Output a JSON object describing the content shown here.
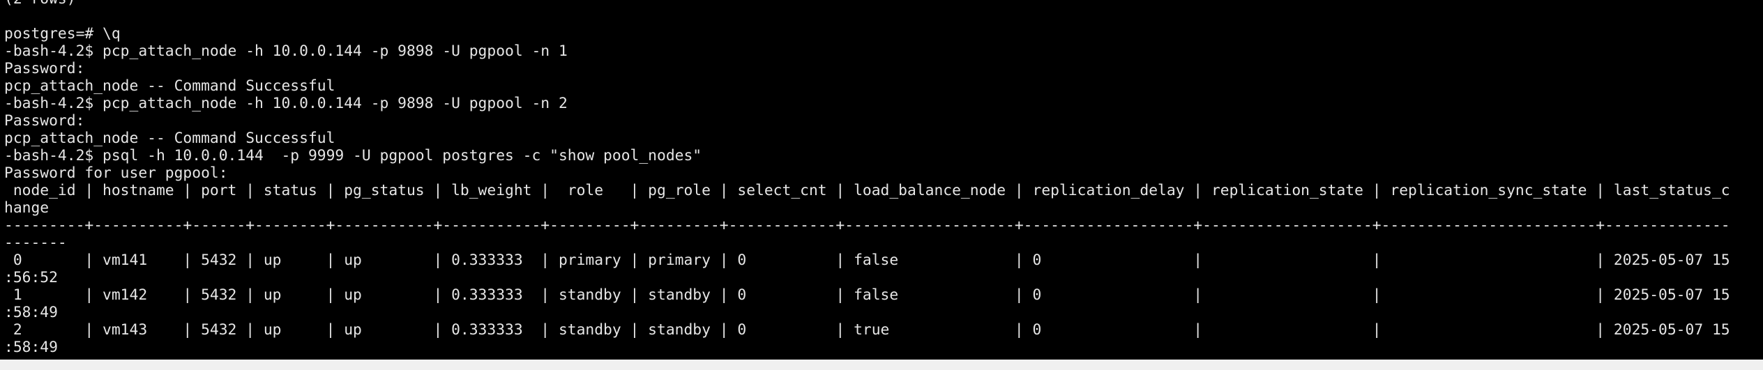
{
  "terminal": {
    "lines": [
      "(2 rows)",
      "",
      "postgres=# \\q",
      "-bash-4.2$ pcp_attach_node -h 10.0.0.144 -p 9898 -U pgpool -n 1",
      "Password:",
      "pcp_attach_node -- Command Successful",
      "-bash-4.2$ pcp_attach_node -h 10.0.0.144 -p 9898 -U pgpool -n 2",
      "Password:",
      "pcp_attach_node -- Command Successful",
      "-bash-4.2$ psql -h 10.0.0.144  -p 9999 -U pgpool postgres -c \"show pool_nodes\"",
      "Password for user pgpool:",
      " node_id | hostname | port | status | pg_status | lb_weight |  role   | pg_role | select_cnt | load_balance_node | replication_delay | replication_state | replication_sync_state | last_status_c",
      "hange",
      "---------+----------+------+--------+-----------+-----------+---------+---------+------------+-------------------+-------------------+-------------------+------------------------+--------------",
      "-------",
      " 0       | vm141    | 5432 | up     | up        | 0.333333  | primary | primary | 0          | false             | 0                 |                   |                        | 2025-05-07 15",
      ":56:52",
      " 1       | vm142    | 5432 | up     | up        | 0.333333  | standby | standby | 0          | false             | 0                 |                   |                        | 2025-05-07 15",
      ":58:49",
      " 2       | vm143    | 5432 | up     | up        | 0.333333  | standby | standby | 0          | true              | 0                 |                   |                        | 2025-05-07 15",
      ":58:49"
    ]
  },
  "colors": {
    "background": "#000000",
    "foreground": "#e6e6e6",
    "bottom_strip": "#f0f0f0"
  }
}
